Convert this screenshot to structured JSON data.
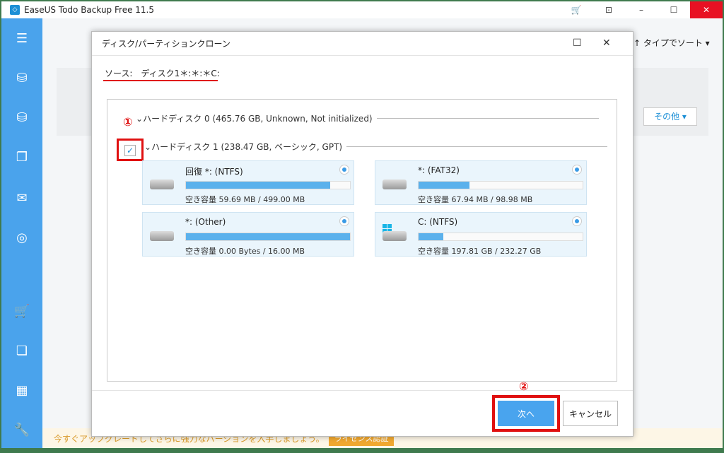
{
  "app": {
    "title": "EaseUS Todo Backup Free 11.5",
    "sort_label": "↑ タイプでソート ▾",
    "other_button": "その他 ▾",
    "promo_text": "今すぐアップグレードしてさらに強力なバージョンを入手しましょう。",
    "license_button": "ライセンス認証"
  },
  "sidebar": {
    "items": [
      {
        "icon": "menu-icon"
      },
      {
        "icon": "disk-backup-icon"
      },
      {
        "icon": "system-backup-icon"
      },
      {
        "icon": "file-backup-icon"
      },
      {
        "icon": "mail-backup-icon"
      },
      {
        "icon": "smart-backup-icon"
      },
      {
        "icon": "cart-icon"
      },
      {
        "icon": "clone-icon"
      },
      {
        "icon": "apps-icon"
      },
      {
        "icon": "tools-icon"
      }
    ]
  },
  "dialog": {
    "title": "ディスク/パーティションクローン",
    "source": "ソース:　ディスク1＊:＊:＊C:",
    "disks": [
      {
        "label": "ハードディスク 0 (465.76 GB, Unknown, Not initialized)",
        "checked": false
      },
      {
        "label": "ハードディスク 1 (238.47 GB, ベーシック, GPT)",
        "checked": true
      }
    ],
    "partitions": [
      {
        "name": "回復 *: (NTFS)",
        "capacity": "空き容量 59.69 MB / 499.00 MB",
        "used_percent": 88
      },
      {
        "name": "*: (FAT32)",
        "capacity": "空き容量 67.94 MB / 98.98 MB",
        "used_percent": 31
      },
      {
        "name": "*: (Other)",
        "capacity": "空き容量 0.00 Bytes / 16.00 MB",
        "used_percent": 100
      },
      {
        "name": "C: (NTFS)",
        "capacity": "空き容量 197.81 GB / 232.27 GB",
        "used_percent": 15
      }
    ],
    "next_button": "次へ",
    "cancel_button": "キャンセル",
    "marker1": "①",
    "marker2": "②"
  },
  "colors": {
    "accent": "#49a4ee",
    "highlight": "#e01010",
    "sidebar": "#4aa3ec"
  }
}
